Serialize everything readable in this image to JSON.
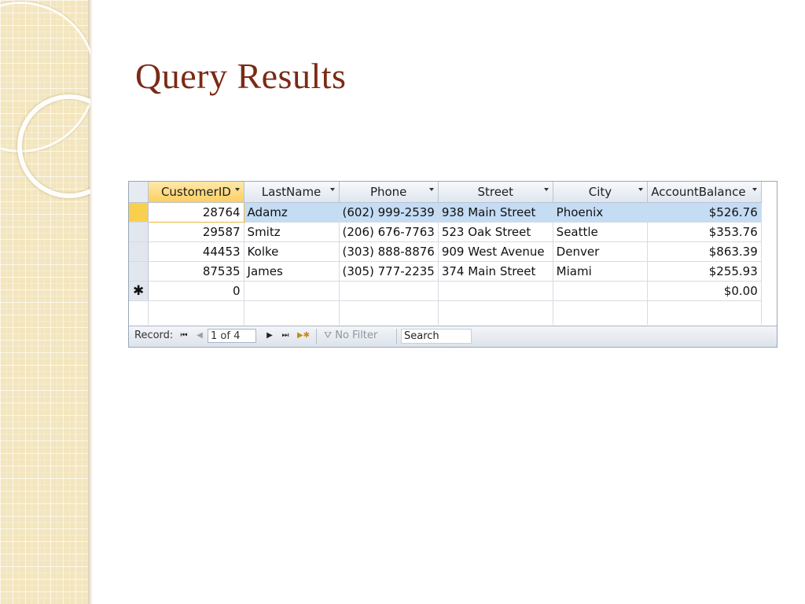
{
  "slide": {
    "title": "Query Results"
  },
  "datasheet": {
    "columns": [
      {
        "label": "CustomerID"
      },
      {
        "label": "LastName"
      },
      {
        "label": "Phone"
      },
      {
        "label": "Street"
      },
      {
        "label": "City"
      },
      {
        "label": "AccountBalance"
      }
    ],
    "rows": [
      {
        "id": "28764",
        "last": "Adamz",
        "phone": "(602) 999-2539",
        "street": "938 Main Street",
        "city": "Phoenix",
        "balance": "$526.76"
      },
      {
        "id": "29587",
        "last": "Smitz",
        "phone": "(206) 676-7763",
        "street": "523 Oak Street",
        "city": "Seattle",
        "balance": "$353.76"
      },
      {
        "id": "44453",
        "last": "Kolke",
        "phone": "(303) 888-8876",
        "street": "909 West Avenue",
        "city": "Denver",
        "balance": "$863.39"
      },
      {
        "id": "87535",
        "last": "James",
        "phone": "(305) 777-2235",
        "street": "374 Main Street",
        "city": "Miami",
        "balance": "$255.93"
      }
    ],
    "new_row": {
      "marker": "✱",
      "id": "0",
      "balance": "$0.00"
    }
  },
  "navigation": {
    "record_label": "Record:",
    "first": "⏮",
    "prev": "◀",
    "position": "1 of 4",
    "next": "▶",
    "last": "⏭",
    "new": "▶✱",
    "filter_label": "No Filter",
    "search": "Search"
  }
}
